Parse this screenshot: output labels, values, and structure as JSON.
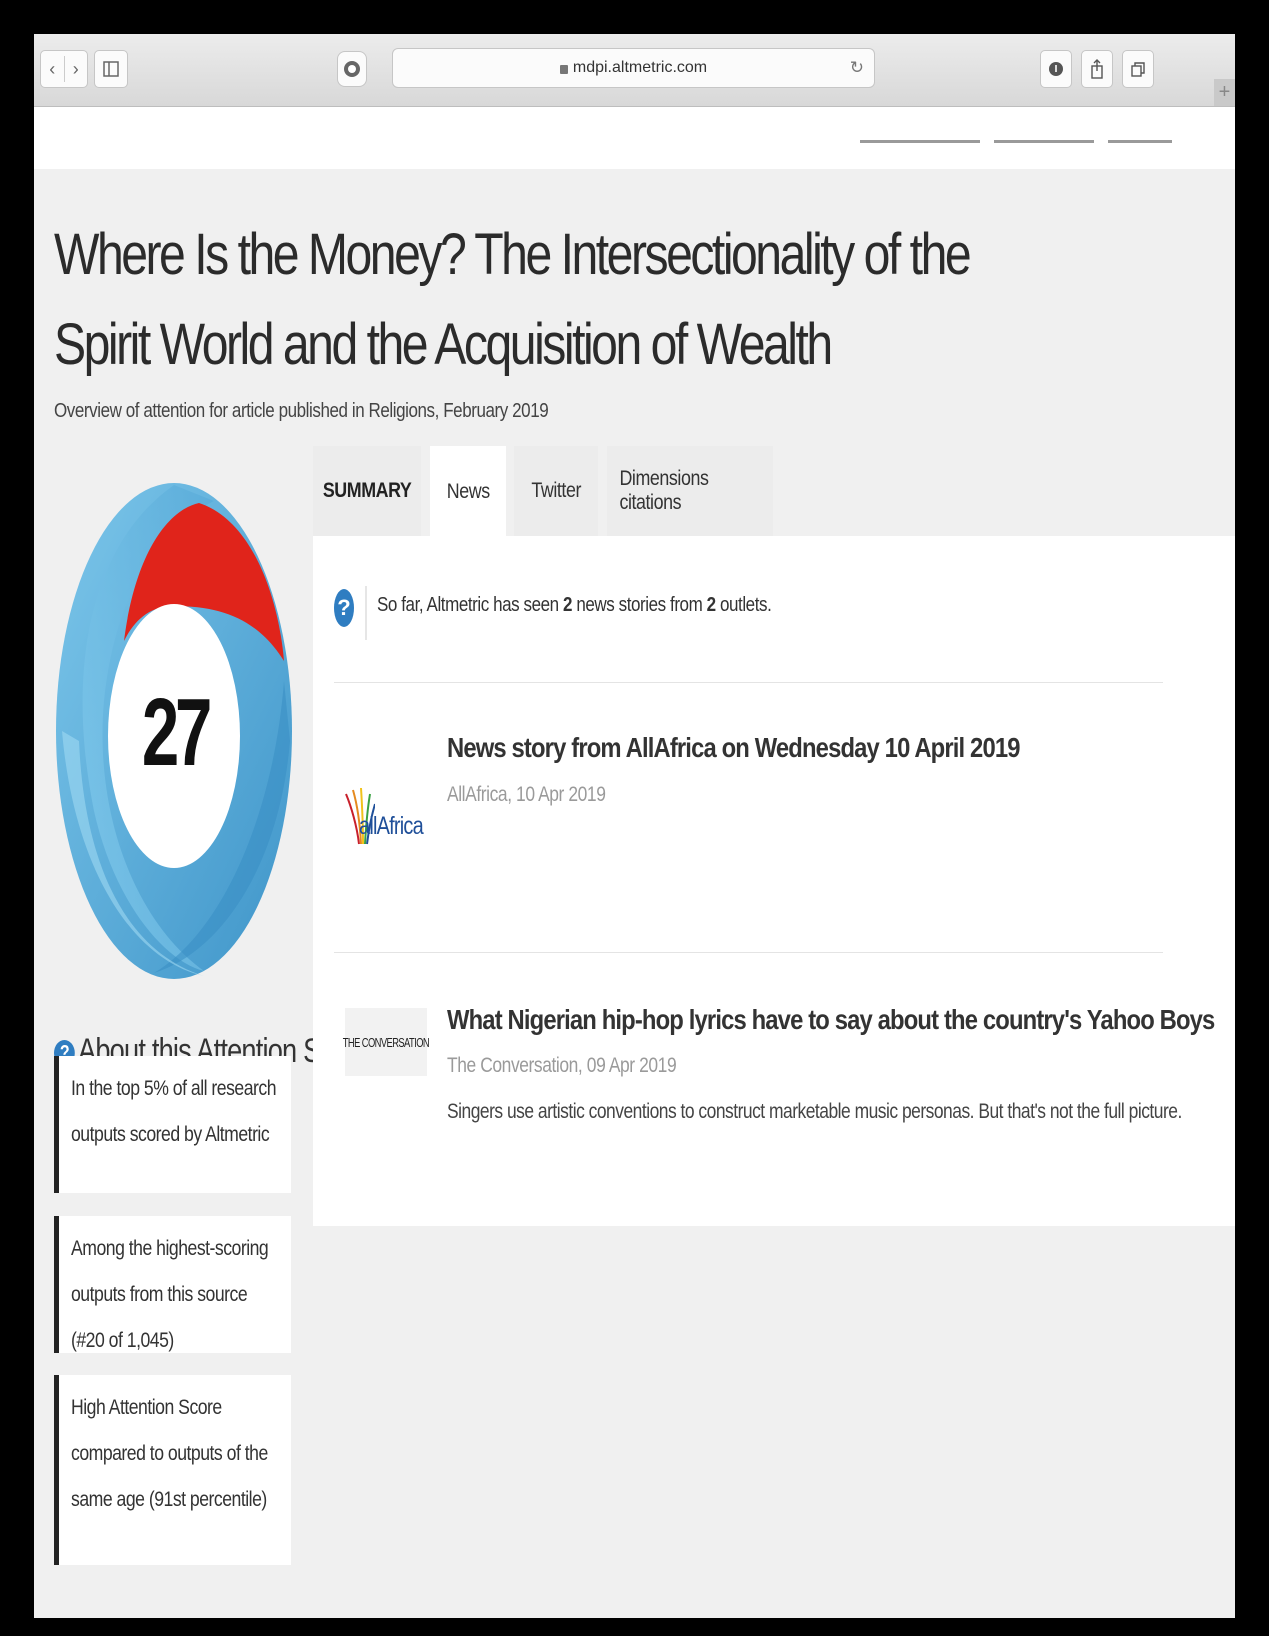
{
  "browser": {
    "url": "mdpi.altmetric.com",
    "icons": [
      "back-icon",
      "forward-icon",
      "sidebar-icon",
      "reader-icon",
      "lock-icon",
      "reload-icon",
      "download-icon",
      "share-icon",
      "tabs-icon",
      "new-tab-icon"
    ]
  },
  "article": {
    "title": "Where Is the Money? The Intersectionality of the Spirit World and the Acquisition of Wealth",
    "subtitle": "Overview of attention for article published in Religions, February 2019"
  },
  "score": {
    "value": "27",
    "colors": {
      "blue": "#5aaed8",
      "red": "#e0241b"
    }
  },
  "about": {
    "title": "About this Attention Score",
    "cards": [
      "In the top 5% of all research outputs scored by Altmetric",
      "Among the highest-scoring outputs from this source (#20 of 1,045)",
      "High Attention Score compared to outputs of the same age (91st percentile)"
    ]
  },
  "tabs": [
    {
      "label": "SUMMARY"
    },
    {
      "label": "News",
      "active": true
    },
    {
      "label": "Twitter"
    },
    {
      "label": "Dimensions citations"
    }
  ],
  "news": {
    "intro_prefix": "So far, Altmetric has seen ",
    "story_count": "2",
    "intro_mid": " news stories from ",
    "outlet_count": "2",
    "intro_suffix": " outlets.",
    "stories": [
      {
        "title": "News story from AllAfrica on Wednesday 10 April 2019",
        "meta": "AllAfrica, 10 Apr 2019",
        "logo_text": "allAfrica"
      },
      {
        "title": "What Nigerian hip-hop lyrics have to say about the country's Yahoo Boys",
        "meta": "The Conversation, 09 Apr 2019",
        "description": "Singers use artistic conventions to construct marketable music personas. But that's not the full picture.",
        "logo_text": "THE CONVERSATION"
      }
    ]
  }
}
